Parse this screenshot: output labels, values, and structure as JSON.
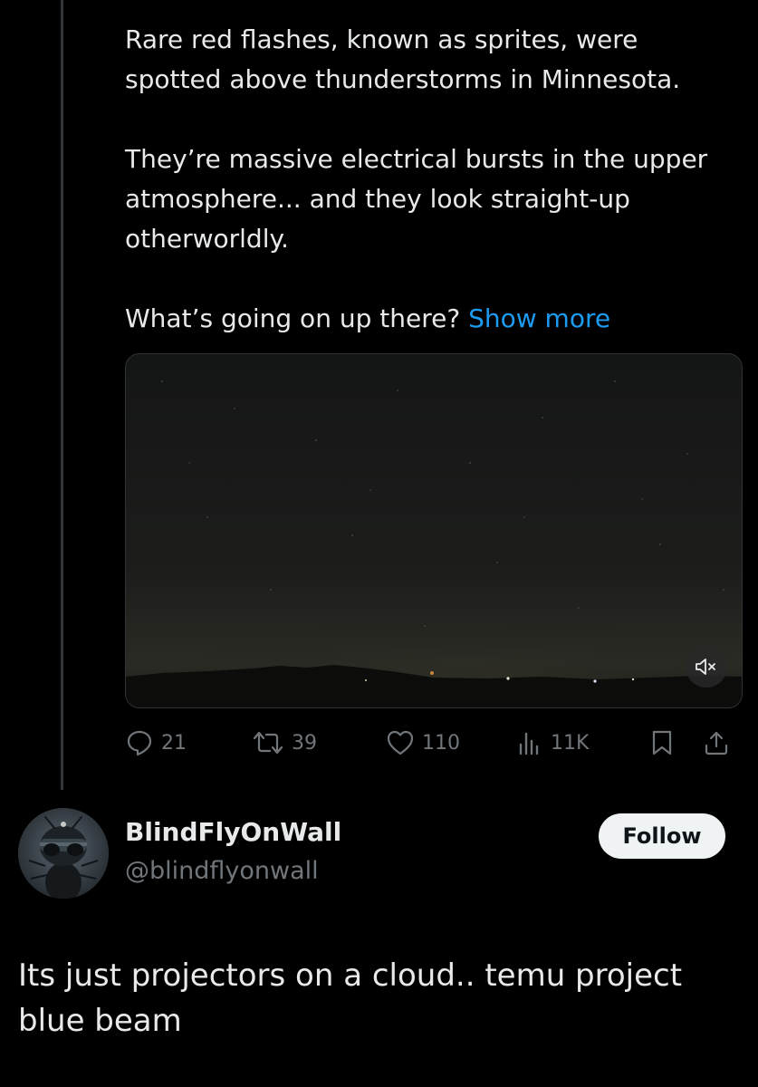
{
  "tweet": {
    "paragraphs": [
      "Rare red flashes, known as sprites, were spotted above thunderstorms in Minnesota.",
      "They’re massive electrical bursts in the upper atmosphere... and they look straight-up otherworldly.",
      "What’s going on up there?"
    ],
    "show_more_label": "Show more",
    "media": {
      "mute_icon": "speaker-muted-icon"
    },
    "actions": {
      "reply_count": "21",
      "retweet_count": "39",
      "like_count": "110",
      "views_count": "11K",
      "icons": [
        "reply-icon",
        "retweet-icon",
        "like-icon",
        "views-icon",
        "bookmark-icon",
        "share-icon"
      ]
    }
  },
  "reply": {
    "display_name": "BlindFlyOnWall",
    "handle": "@blindflyonwall",
    "follow_label": "Follow",
    "text": "Its just projectors on a cloud.. temu project blue beam"
  },
  "colors": {
    "background": "#000000",
    "text": "#e7e9ea",
    "muted": "#71767b",
    "link": "#1d9bf0",
    "follow_bg": "#eff3f4"
  }
}
